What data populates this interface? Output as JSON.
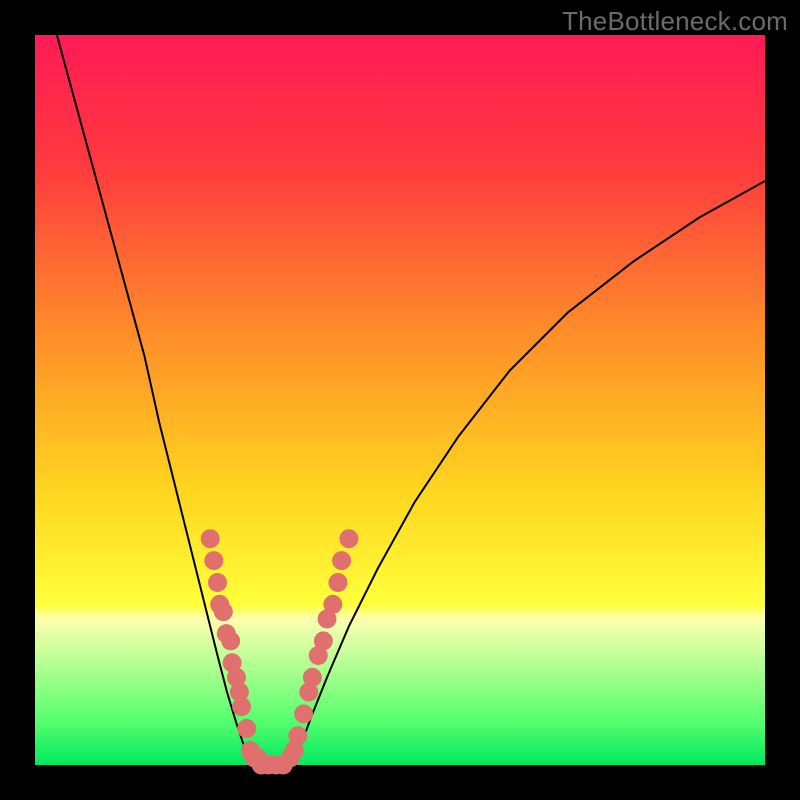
{
  "watermark": "TheBottleneck.com",
  "chart_data": {
    "type": "line",
    "title": "",
    "xlabel": "",
    "ylabel": "",
    "xlim": [
      0,
      100
    ],
    "ylim": [
      0,
      100
    ],
    "gradient_stops": [
      {
        "pct": 0,
        "color": "#ff1b55"
      },
      {
        "pct": 18,
        "color": "#ff3a3f"
      },
      {
        "pct": 40,
        "color": "#ff8a2a"
      },
      {
        "pct": 62,
        "color": "#ffd41f"
      },
      {
        "pct": 78,
        "color": "#ffff3a"
      },
      {
        "pct": 80,
        "color": "#fdffb0"
      },
      {
        "pct": 94,
        "color": "#56ff6e"
      },
      {
        "pct": 100,
        "color": "#00e85f"
      }
    ],
    "series": [
      {
        "name": "left-branch",
        "x": [
          3,
          6,
          9,
          12,
          15,
          17,
          19,
          20.5,
          22,
          23.5,
          25,
          26.3,
          27.5,
          28.5,
          29.3,
          30
        ],
        "y": [
          100,
          89,
          78,
          67,
          56,
          47,
          39,
          33,
          27,
          21,
          15,
          10,
          6,
          3,
          1,
          0
        ]
      },
      {
        "name": "valley-floor",
        "x": [
          30,
          31,
          32,
          33,
          34,
          35
        ],
        "y": [
          0,
          0,
          0,
          0,
          0,
          0
        ]
      },
      {
        "name": "right-branch",
        "x": [
          35,
          36.5,
          38,
          40,
          43,
          47,
          52,
          58,
          65,
          73,
          82,
          91,
          100
        ],
        "y": [
          0,
          3,
          7,
          12,
          19,
          27,
          36,
          45,
          54,
          62,
          69,
          75,
          80
        ]
      }
    ],
    "scatter": {
      "name": "data-points",
      "color": "#e0706e",
      "radius": 1.3,
      "points": [
        {
          "x": 24.0,
          "y": 31
        },
        {
          "x": 24.5,
          "y": 28
        },
        {
          "x": 25.0,
          "y": 25
        },
        {
          "x": 25.3,
          "y": 22
        },
        {
          "x": 25.8,
          "y": 21
        },
        {
          "x": 26.2,
          "y": 18
        },
        {
          "x": 26.8,
          "y": 17
        },
        {
          "x": 27.0,
          "y": 14
        },
        {
          "x": 27.6,
          "y": 12
        },
        {
          "x": 28.0,
          "y": 10
        },
        {
          "x": 28.3,
          "y": 8
        },
        {
          "x": 29.0,
          "y": 5
        },
        {
          "x": 29.5,
          "y": 2
        },
        {
          "x": 30.0,
          "y": 1
        },
        {
          "x": 30.5,
          "y": 1
        },
        {
          "x": 31.0,
          "y": 0
        },
        {
          "x": 32.0,
          "y": 0
        },
        {
          "x": 33.0,
          "y": 0
        },
        {
          "x": 34.0,
          "y": 0
        },
        {
          "x": 35.0,
          "y": 1
        },
        {
          "x": 35.5,
          "y": 2
        },
        {
          "x": 36.0,
          "y": 4
        },
        {
          "x": 36.8,
          "y": 7
        },
        {
          "x": 37.5,
          "y": 10
        },
        {
          "x": 38.0,
          "y": 12
        },
        {
          "x": 38.8,
          "y": 15
        },
        {
          "x": 39.5,
          "y": 17
        },
        {
          "x": 40.0,
          "y": 20
        },
        {
          "x": 40.8,
          "y": 22
        },
        {
          "x": 41.5,
          "y": 25
        },
        {
          "x": 42.0,
          "y": 28
        },
        {
          "x": 43.0,
          "y": 31
        }
      ]
    }
  }
}
